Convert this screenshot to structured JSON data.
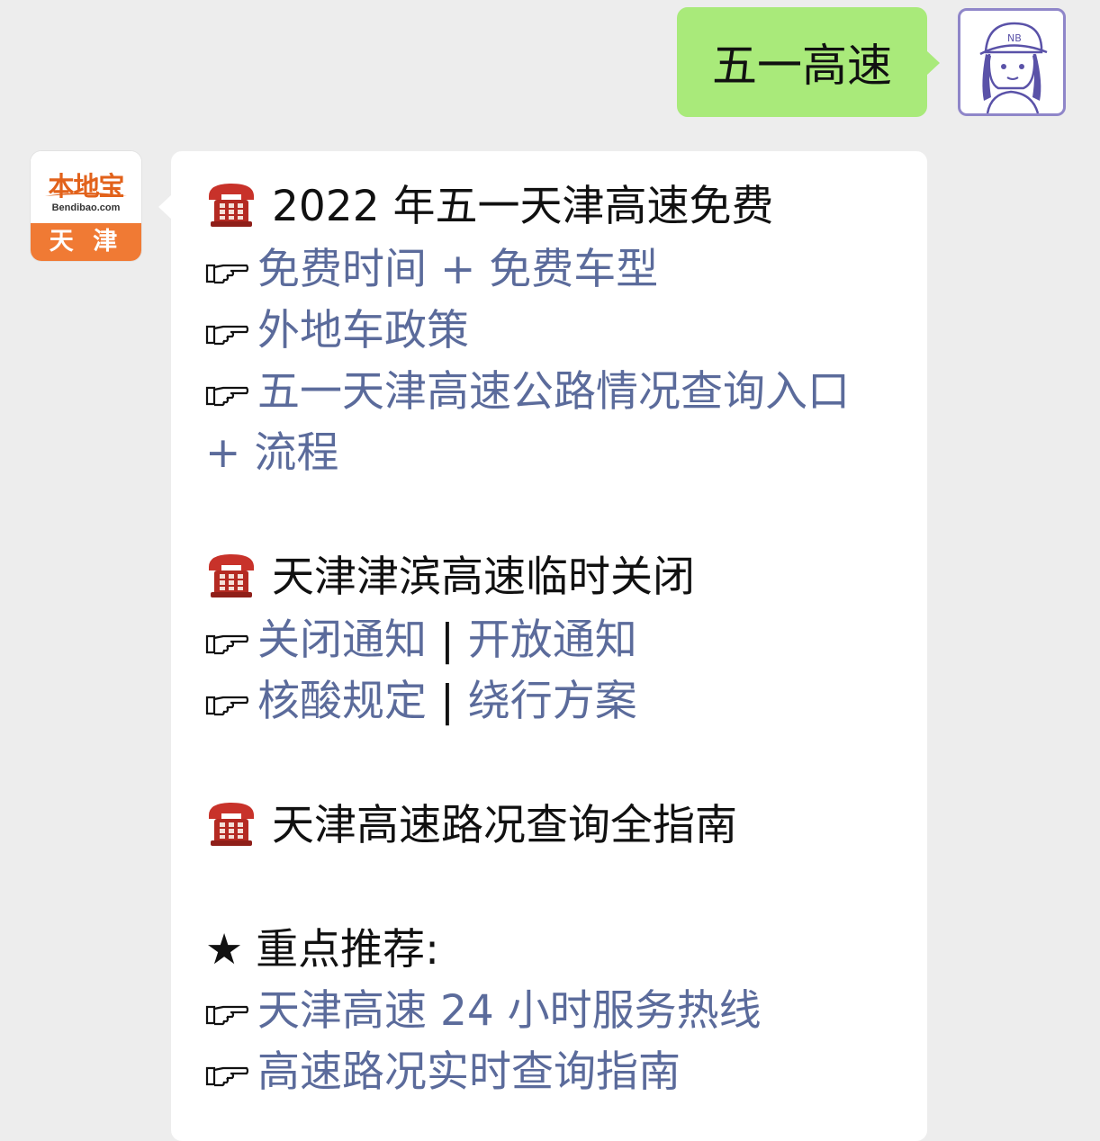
{
  "outgoing": {
    "text": "五一高速"
  },
  "bot": {
    "brand": "本地宝",
    "site": "Bendibao.com",
    "city": "天 津"
  },
  "message": {
    "section1": {
      "title": "2022 年五一天津高速免费",
      "links": [
        "免费时间 + 免费车型",
        "外地车政策",
        "五一天津高速公路情况查询入口",
        "+ 流程"
      ]
    },
    "section2": {
      "title": "天津津滨高速临时关闭",
      "row1": {
        "a": "关闭通知",
        "sep": " | ",
        "b": "开放通知"
      },
      "row2": {
        "a": "核酸规定",
        "sep": " | ",
        "b": "绕行方案"
      }
    },
    "section3": {
      "title": "天津高速路况查询全指南"
    },
    "featured": {
      "star": "★",
      "label": "重点推荐:",
      "links": [
        "天津高速 24 小时服务热线",
        "高速路况实时查询指南"
      ]
    }
  },
  "icons": {
    "phone": "telephone-icon",
    "hand": "pointing-hand-icon"
  },
  "colors": {
    "outgoing_bubble": "#a9ea7a",
    "link": "#5b6b9b",
    "brand_orange": "#f07a34",
    "phone_red": "#c8322a"
  }
}
